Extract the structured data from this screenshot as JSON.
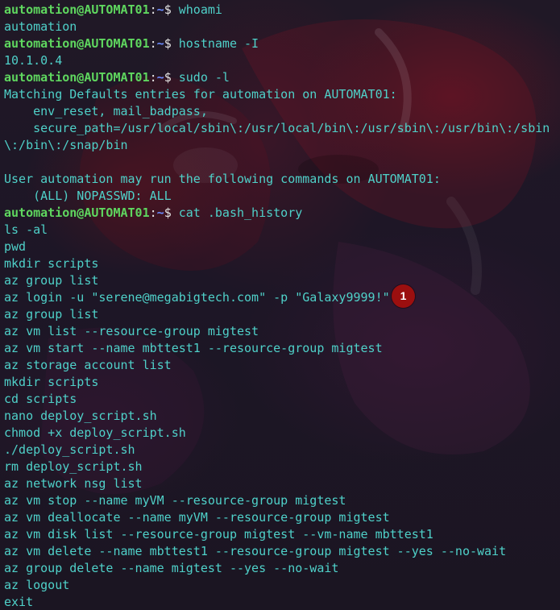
{
  "prompt": {
    "user": "automation@AUTOMAT01",
    "colon": ":",
    "path": "~",
    "symbol": "$"
  },
  "lines": [
    {
      "type": "prompt",
      "command": " whoami"
    },
    {
      "type": "output",
      "text": "automation"
    },
    {
      "type": "prompt",
      "command": " hostname -I"
    },
    {
      "type": "output",
      "text": "10.1.0.4"
    },
    {
      "type": "prompt",
      "command": " sudo -l"
    },
    {
      "type": "output",
      "text": "Matching Defaults entries for automation on AUTOMAT01:"
    },
    {
      "type": "output",
      "text": "    env_reset, mail_badpass,"
    },
    {
      "type": "output",
      "text": "    secure_path=/usr/local/sbin\\:/usr/local/bin\\:/usr/sbin\\:/usr/bin\\:/sbin"
    },
    {
      "type": "output",
      "text": "\\:/bin\\:/snap/bin"
    },
    {
      "type": "output",
      "text": ""
    },
    {
      "type": "output",
      "text": "User automation may run the following commands on AUTOMAT01:"
    },
    {
      "type": "output",
      "text": "    (ALL) NOPASSWD: ALL"
    },
    {
      "type": "prompt",
      "command": " cat .bash_history"
    },
    {
      "type": "output",
      "text": "ls -al"
    },
    {
      "type": "output",
      "text": "pwd"
    },
    {
      "type": "output",
      "text": "mkdir scripts"
    },
    {
      "type": "output",
      "text": "az group list"
    },
    {
      "type": "output",
      "text": "az login -u \"serene@megabigtech.com\" -p \"Galaxy9999!\""
    },
    {
      "type": "output",
      "text": "az group list"
    },
    {
      "type": "output",
      "text": "az vm list --resource-group migtest"
    },
    {
      "type": "output",
      "text": "az vm start --name mbttest1 --resource-group migtest"
    },
    {
      "type": "output",
      "text": "az storage account list"
    },
    {
      "type": "output",
      "text": "mkdir scripts"
    },
    {
      "type": "output",
      "text": "cd scripts"
    },
    {
      "type": "output",
      "text": "nano deploy_script.sh"
    },
    {
      "type": "output",
      "text": "chmod +x deploy_script.sh"
    },
    {
      "type": "output",
      "text": "./deploy_script.sh"
    },
    {
      "type": "output",
      "text": "rm deploy_script.sh"
    },
    {
      "type": "output",
      "text": "az network nsg list"
    },
    {
      "type": "output",
      "text": "az vm stop --name myVM --resource-group migtest"
    },
    {
      "type": "output",
      "text": "az vm deallocate --name myVM --resource-group migtest"
    },
    {
      "type": "output",
      "text": "az vm disk list --resource-group migtest --vm-name mbttest1"
    },
    {
      "type": "output",
      "text": "az vm delete --name mbttest1 --resource-group migtest --yes --no-wait"
    },
    {
      "type": "output",
      "text": "az group delete --name migtest --yes --no-wait"
    },
    {
      "type": "output",
      "text": "az logout"
    },
    {
      "type": "output",
      "text": "exit"
    }
  ],
  "annotation": {
    "label": "1",
    "color": "#9b0f0f"
  },
  "colors": {
    "background": "#1c1424",
    "text": "#4fd1c9",
    "prompt_user": "#5fd75f",
    "prompt_path": "#6b8cff"
  }
}
